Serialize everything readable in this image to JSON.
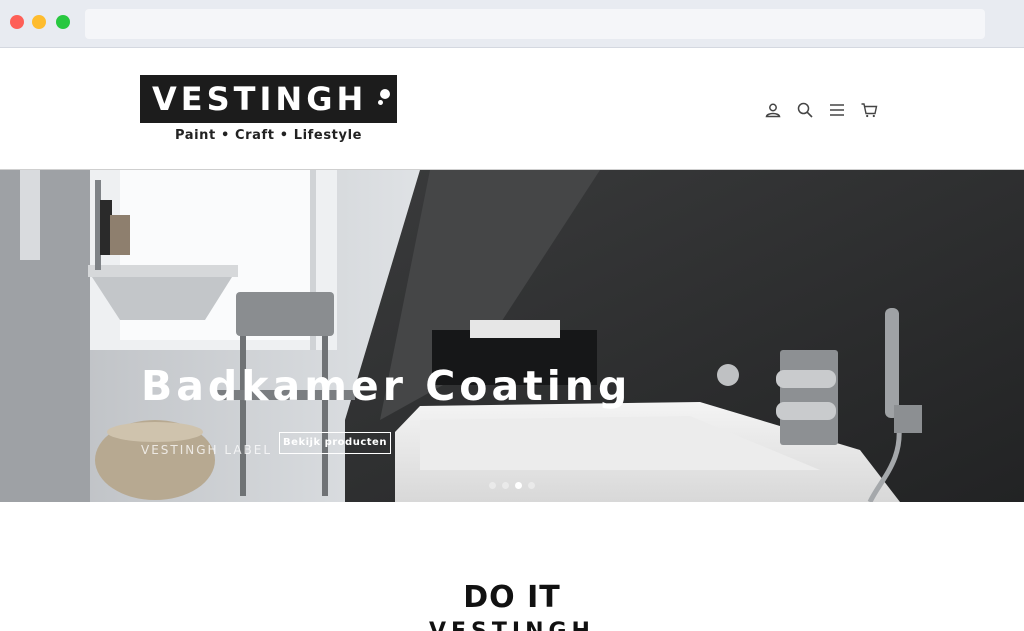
{
  "browser": {
    "url": ""
  },
  "header": {
    "logo_text": "VESTINGH",
    "tagline": "Paint • Craft • Lifestyle",
    "icons": [
      "account-icon",
      "search-icon",
      "menu-icon",
      "cart-icon"
    ]
  },
  "hero": {
    "title": "Badkamer Coating",
    "subtitle": "VESTINGH LABEL",
    "button_label": "Bekijk producten",
    "slides_count": 4,
    "active_slide": 3
  },
  "section": {
    "heading": "DO IT",
    "subheading": "VESTINGH"
  },
  "colors": {
    "logo_bg": "#1c1c1c",
    "chrome_bg": "#e8ebf1",
    "text": "#111111"
  }
}
